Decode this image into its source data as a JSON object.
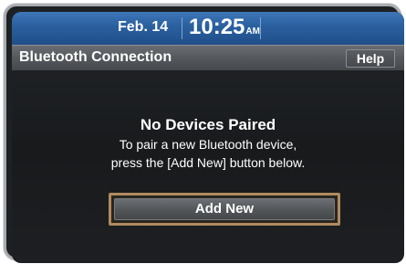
{
  "status_bar": {
    "date": "Feb. 14",
    "time": "10:25",
    "ampm": "AM"
  },
  "title_bar": {
    "title": "Bluetooth Connection",
    "help_label": "Help"
  },
  "message": {
    "title": "No Devices Paired",
    "line1": "To pair a new Bluetooth device,",
    "line2": "press the [Add New] button below."
  },
  "actions": {
    "add_new_label": "Add New"
  },
  "colors": {
    "status_bar": "#2a5f9e",
    "title_bar": "#55585c",
    "screen_bg": "#1e2124",
    "highlight": "#b08a5e"
  }
}
